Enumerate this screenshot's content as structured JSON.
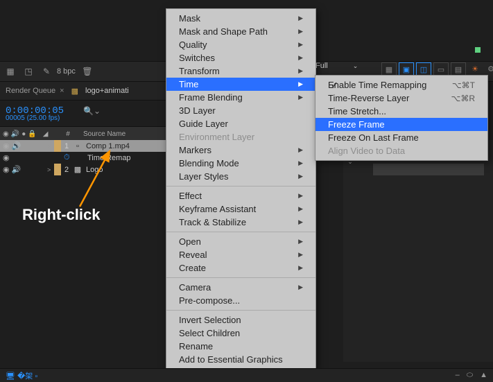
{
  "topbar": {
    "bpc_label": "8 bpc"
  },
  "tabs": {
    "render_queue": "Render Queue",
    "comp": "logo+animati"
  },
  "timecode": "0:00:00:05",
  "fps": "00005 (25.00 fps)",
  "columns": {
    "source_name": "Source Name",
    "num": "#"
  },
  "layers": [
    {
      "num": "1",
      "name": "Comp 1.mp4",
      "color": "#cfa760",
      "selected": true
    },
    {
      "num": "",
      "name": "Time Remap",
      "color": "#cfa760",
      "selected": false,
      "indent": true,
      "clock": true
    },
    {
      "num": "2",
      "name": "Logo",
      "color": "#cfa760",
      "selected": false
    }
  ],
  "annotation": "Right-click",
  "resolution": "Full",
  "menu1": [
    {
      "t": "Mask",
      "sub": true
    },
    {
      "t": "Mask and Shape Path",
      "sub": true
    },
    {
      "t": "Quality",
      "sub": true
    },
    {
      "t": "Switches",
      "sub": true
    },
    {
      "t": "Transform",
      "sub": true
    },
    {
      "t": "Time",
      "sub": true,
      "hi": true
    },
    {
      "t": "Frame Blending",
      "sub": true
    },
    {
      "t": "3D Layer"
    },
    {
      "t": "Guide Layer"
    },
    {
      "t": "Environment Layer",
      "dis": true
    },
    {
      "t": "Markers",
      "sub": true
    },
    {
      "t": "Blending Mode",
      "sub": true
    },
    {
      "t": "Layer Styles",
      "sub": true
    },
    {
      "sep": true
    },
    {
      "t": "Effect",
      "sub": true
    },
    {
      "t": "Keyframe Assistant",
      "sub": true
    },
    {
      "t": "Track & Stabilize",
      "sub": true
    },
    {
      "sep": true
    },
    {
      "t": "Open",
      "sub": true
    },
    {
      "t": "Reveal",
      "sub": true
    },
    {
      "t": "Create",
      "sub": true
    },
    {
      "sep": true
    },
    {
      "t": "Camera",
      "sub": true
    },
    {
      "t": "Pre-compose..."
    },
    {
      "sep": true
    },
    {
      "t": "Invert Selection"
    },
    {
      "t": "Select Children"
    },
    {
      "t": "Rename"
    },
    {
      "t": "Add to Essential Graphics"
    }
  ],
  "menu2": [
    {
      "t": "Enable Time Remapping",
      "check": true,
      "short": "⌥⌘T"
    },
    {
      "t": "Time-Reverse Layer",
      "short": "⌥⌘R"
    },
    {
      "t": "Time Stretch..."
    },
    {
      "t": "Freeze Frame",
      "hi": true
    },
    {
      "t": "Freeze On Last Frame"
    },
    {
      "t": "Align Video to Data",
      "dis": true
    }
  ]
}
